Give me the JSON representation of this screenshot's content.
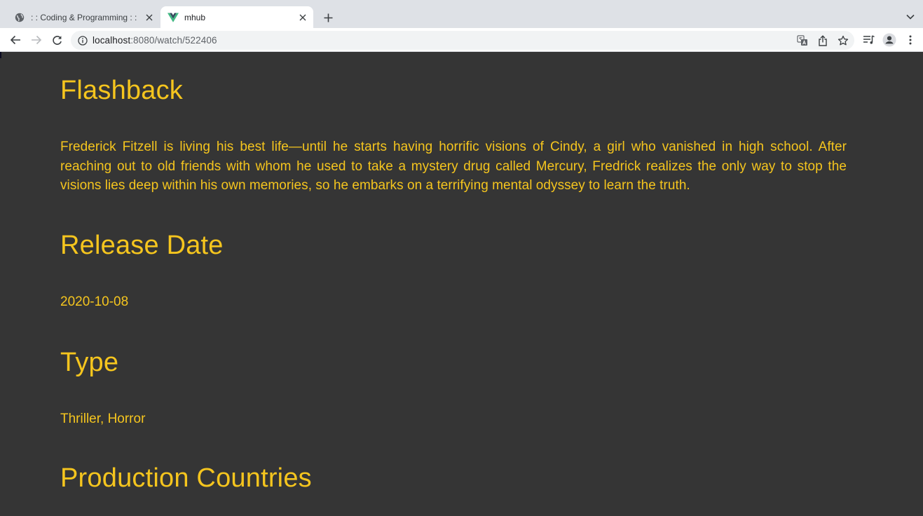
{
  "browser": {
    "tabs": [
      {
        "title": ": : Coding & Programming : :",
        "favicon": "globe-icon",
        "active": false
      },
      {
        "title": "mhub",
        "favicon": "vue-logo-icon",
        "active": true
      }
    ],
    "url_host": "localhost",
    "url_path": ":8080/watch/522406"
  },
  "movie": {
    "title": "Flashback",
    "overview": "Frederick Fitzell is living his best life—until he starts having horrific visions of Cindy, a girl who vanished in high school. After reaching out to old friends with whom he used to take a mystery drug called Mercury, Fredrick realizes the only way to stop the visions lies deep within his own memories, so he embarks on a terrifying mental odyssey to learn the truth.",
    "release_date_heading": "Release Date",
    "release_date": "2020-10-08",
    "type_heading": "Type",
    "type": "Thriller, Horror",
    "countries_heading": "Production Countries"
  },
  "colors": {
    "page_background": "#353535",
    "accent_text": "#f5c51e",
    "vue_green": "#41b883",
    "vue_dark": "#35495e"
  }
}
